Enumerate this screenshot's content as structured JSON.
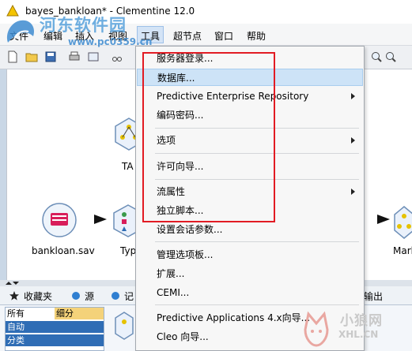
{
  "window": {
    "title": "bayes_bankloan* - Clementine 12.0"
  },
  "watermark": {
    "site_name": "河东软件园",
    "url": "www.pc0359.cn",
    "brand2_name": "小狼网",
    "brand2_url": "XHL.CN"
  },
  "menubar": {
    "items": [
      {
        "label": "文件"
      },
      {
        "label": "编辑"
      },
      {
        "label": "插入"
      },
      {
        "label": "视图"
      },
      {
        "label": "工具"
      },
      {
        "label": "超节点"
      },
      {
        "label": "窗口"
      },
      {
        "label": "帮助"
      }
    ]
  },
  "tools_menu": {
    "items": [
      {
        "label": "服务器登录..."
      },
      {
        "label": "数据库..."
      },
      {
        "label": "Predictive Enterprise Repository"
      },
      {
        "label": "编码密码..."
      },
      {
        "label": "选项"
      },
      {
        "label": "许可向导..."
      },
      {
        "label": "流属性"
      },
      {
        "label": "独立脚本..."
      },
      {
        "label": "设置会话参数..."
      },
      {
        "label": "管理选项板..."
      },
      {
        "label": "扩展..."
      },
      {
        "label": "CEMI..."
      },
      {
        "label": "Predictive Applications 4.x向导..."
      },
      {
        "label": "Cleo 向导..."
      }
    ]
  },
  "canvas": {
    "nodes": [
      {
        "label": "bankloan.sav"
      },
      {
        "label": "Typ"
      },
      {
        "label": "TA"
      },
      {
        "label": "Mark"
      }
    ]
  },
  "bottom_tabs": [
    {
      "label": "收藏夹"
    },
    {
      "label": "源"
    },
    {
      "label": "记"
    },
    {
      "label": "输出"
    }
  ],
  "categories": [
    {
      "label": "所有"
    },
    {
      "label": "细分"
    },
    {
      "label": "自动"
    },
    {
      "label": "分类"
    }
  ],
  "colors": {
    "highlight": "#cde3f7",
    "annotation_box": "#e21b23",
    "menu_active": "#d4e4f6"
  }
}
